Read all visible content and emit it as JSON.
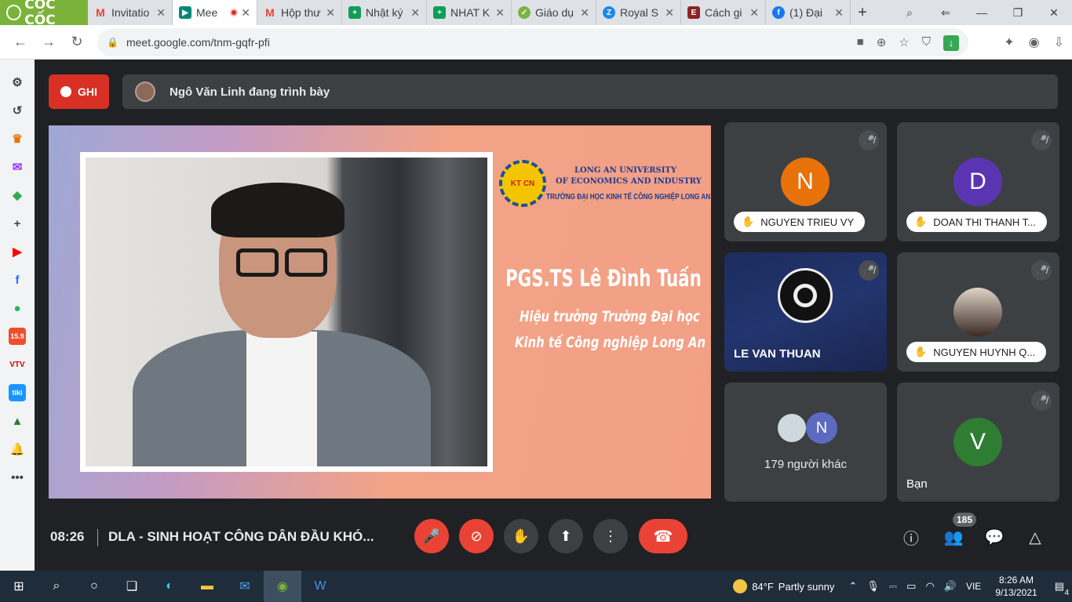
{
  "browser": {
    "brand": "CỐC CỐC",
    "tabs": [
      {
        "label": "Invitatio",
        "icon": "M",
        "color": "#ea4335"
      },
      {
        "label": "Mee",
        "icon": "▶",
        "color": "#00897b",
        "active": true,
        "recording": true
      },
      {
        "label": "Hộp thư",
        "icon": "M",
        "color": "#ea4335"
      },
      {
        "label": "Nhật ký",
        "icon": "+",
        "color": "#0f9d58"
      },
      {
        "label": "NHAT K",
        "icon": "+",
        "color": "#0f9d58"
      },
      {
        "label": "Giáo dụ",
        "icon": "✓",
        "color": "#7cb342"
      },
      {
        "label": "Royal S",
        "icon": "Z",
        "color": "#1e88e5"
      },
      {
        "label": "Cách gi",
        "icon": "E",
        "color": "#8e2424"
      },
      {
        "label": "(1) Đại",
        "icon": "f",
        "color": "#1877f2"
      }
    ],
    "url": "meet.google.com/tnm-gqfr-pfi"
  },
  "meet": {
    "record_label": "GHI",
    "presenting_text": "Ngô Văn Linh đang trình bày",
    "slide": {
      "uni_en_1": "LONG AN UNIVERSITY",
      "uni_en_2": "OF ECONOMICS AND INDUSTRY",
      "uni_vi": "TRƯỜNG ĐẠI HỌC KINH TẾ CÔNG NGHIỆP LONG AN",
      "seal_text": "KT CN",
      "name": "PGS.TS Lê Đình Tuấn",
      "role_1": "Hiệu trưởng Trường Đại học",
      "role_2": "Kinh tế Công nghiệp Long An"
    },
    "participants": [
      {
        "initial": "N",
        "name": "NGUYEN TRIEU VY",
        "color": "#e8710a"
      },
      {
        "initial": "D",
        "name": "DOAN THI THANH T...",
        "color": "#5b35b1"
      },
      {
        "name": "LE VAN THUAN"
      },
      {
        "name": "NGUYEN HUYNH Q..."
      },
      {
        "initial": "N",
        "others": "179 người khác",
        "color": "#5c6bc0"
      },
      {
        "initial": "V",
        "name": "Bạn",
        "color": "#2e7d32"
      }
    ],
    "time": "08:26",
    "meeting_title": "DLA - SINH HOẠT CÔNG DÂN ĐẦU KHÓ...",
    "people_count": "185"
  },
  "taskbar": {
    "temp": "84°F",
    "weather": "Partly sunny",
    "lang": "VIE",
    "time": "8:26 AM",
    "date": "9/13/2021",
    "notifications": "4"
  }
}
